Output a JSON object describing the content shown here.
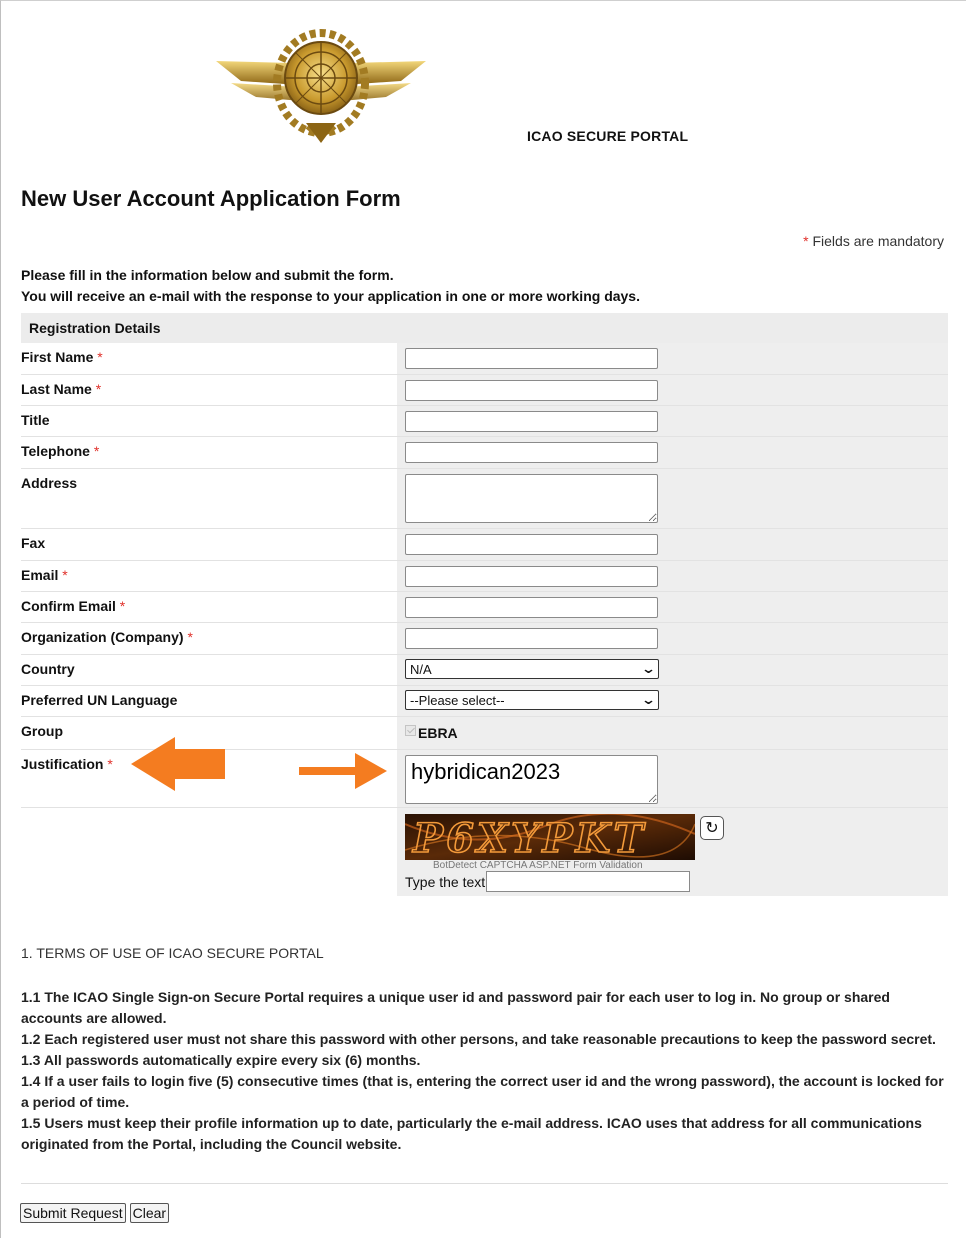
{
  "header": {
    "logo_icon": "icao-emblem-icon",
    "portal_title": "ICAO SECURE PORTAL",
    "form_title": "New User Account Application Form",
    "mandatory_star": "*",
    "mandatory_note": " Fields are mandatory",
    "intro_line1": "Please fill in the information below and submit the form.",
    "intro_line2": "You will receive an e-mail with the response to your application in one or more working days."
  },
  "registration": {
    "section_title": "Registration Details",
    "star": "*",
    "fields": {
      "first_name": {
        "label": "First Name",
        "value": ""
      },
      "last_name": {
        "label": "Last Name",
        "value": ""
      },
      "title": {
        "label": "Title",
        "value": ""
      },
      "telephone": {
        "label": "Telephone",
        "value": ""
      },
      "address": {
        "label": "Address",
        "value": ""
      },
      "fax": {
        "label": "Fax",
        "value": ""
      },
      "email": {
        "label": "Email",
        "value": ""
      },
      "confirm_email": {
        "label": "Confirm Email",
        "value": ""
      },
      "organization": {
        "label": "Organization (Company)",
        "value": ""
      },
      "country": {
        "label": "Country",
        "selected": "N/A"
      },
      "language": {
        "label": "Preferred UN Language",
        "selected": "--Please select--"
      },
      "group": {
        "label": "Group",
        "option": "EBRA",
        "checked": true,
        "disabled": true
      },
      "justification": {
        "label": "Justification",
        "value": "hybridican2023"
      }
    },
    "captcha": {
      "image_text": "P6XYPKT",
      "caption": "BotDetect CAPTCHA ASP.NET Form Validation",
      "type_label": "Type the text",
      "value": "",
      "reload_icon": "reload-icon"
    }
  },
  "annotations": {
    "arrow_left_color": "#f47c20",
    "arrow_right_color": "#f47c20"
  },
  "terms": {
    "title": "1. TERMS OF USE OF ICAO SECURE PORTAL",
    "items": [
      "1.1 The ICAO Single Sign-on Secure Portal requires a unique user id and password pair for each user to log in. No group or shared accounts are allowed.",
      "1.2 Each registered user must not share this password with other persons, and take reasonable precautions to keep the password secret.",
      "1.3 All passwords automatically expire every six (6) months.",
      "1.4 If a user fails to login five (5) consecutive times (that is, entering the correct user id and the wrong password), the account is locked for a period of time.",
      "1.5 Users must keep their profile information up to date, particularly the e-mail address. ICAO uses that address for all communications originated from the Portal, including the Council website."
    ]
  },
  "actions": {
    "submit_label": "Submit Request",
    "clear_label": "Clear"
  }
}
